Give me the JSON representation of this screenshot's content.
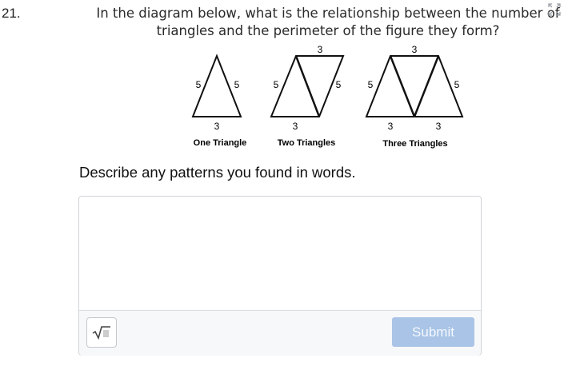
{
  "question": {
    "number": "21.",
    "text": "In the diagram below, what is the relationship between the number of triangles and the perimeter of the figure they form?",
    "expand_icon": "expand-arrows-icon"
  },
  "diagram": {
    "one": {
      "label": "One Triangle",
      "left_side": "5",
      "right_side": "5",
      "bottom": "3"
    },
    "two": {
      "label": "Two Triangles",
      "left_side": "5",
      "right_side": "5",
      "top": "3",
      "bottom": "3"
    },
    "three": {
      "label": "Three Triangles",
      "left_side": "5",
      "right_side": "5",
      "top": "3",
      "bottom_left": "3",
      "bottom_right": "3"
    }
  },
  "prompt": "Describe any patterns you found in words.",
  "answer": {
    "value": "",
    "placeholder": "",
    "math_icon": "square-root-icon",
    "submit_label": "Submit",
    "submit_color": "#a9c4e6"
  }
}
